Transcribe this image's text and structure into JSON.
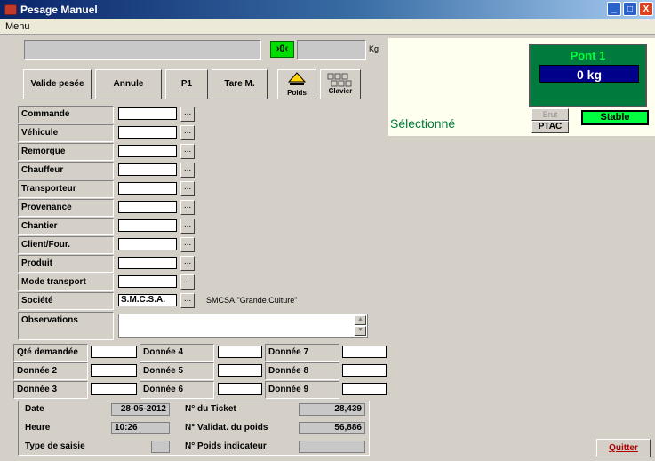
{
  "window": {
    "title": "Pesage Manuel",
    "minimize": "_",
    "maximize": "□",
    "close": "X"
  },
  "menu": {
    "label": "Menu"
  },
  "top": {
    "unit": "Kg",
    "zero_label": "›0‹"
  },
  "buttons": {
    "valide": "Valide pesée",
    "annule": "Annule",
    "p1": "P1",
    "tare": "Tare M.",
    "poids": "Poids",
    "clavier": "Clavier",
    "quitter": "Quitter"
  },
  "fields": [
    {
      "label": "Commande",
      "value": ""
    },
    {
      "label": "Véhicule",
      "value": ""
    },
    {
      "label": "Remorque",
      "value": ""
    },
    {
      "label": "Chauffeur",
      "value": ""
    },
    {
      "label": "Transporteur",
      "value": ""
    },
    {
      "label": "Provenance",
      "value": ""
    },
    {
      "label": "Chantier",
      "value": ""
    },
    {
      "label": "Client/Four.",
      "value": ""
    },
    {
      "label": "Produit",
      "value": ""
    },
    {
      "label": "Mode transport",
      "value": ""
    },
    {
      "label": "Société",
      "value": "S.M.C.S.A."
    }
  ],
  "societe_desc": "SMCSA.\"Grande.Culture\"",
  "observations_label": "Observations",
  "donnees": {
    "qte": "Qté demandée",
    "d2": "Donnée 2",
    "d3": "Donnée 3",
    "d4": "Donnée 4",
    "d5": "Donnée 5",
    "d6": "Donnée 6",
    "d7": "Donnée 7",
    "d8": "Donnée 8",
    "d9": "Donnée 9"
  },
  "info": {
    "date_label": "Date",
    "date": "28-05-2012",
    "heure_label": "Heure",
    "heure": "10:26",
    "type_label": "Type de saisie",
    "ticket_label": "N° du Ticket",
    "ticket": "28,439",
    "validat_label": "N° Validat. du poids",
    "validat": "56,886",
    "indic_label": "N° Poids indicateur"
  },
  "status": {
    "selectionne": "Sélectionné",
    "brut": "Brut",
    "ptac": "PTAC",
    "stable": "Stable"
  },
  "pont": {
    "title": "Pont 1",
    "value": "0 kg"
  },
  "colors": {
    "pont_bg": "#007a3d",
    "pont_display": "#00008b",
    "stable": "#00ff40",
    "zero": "#00ff00"
  }
}
